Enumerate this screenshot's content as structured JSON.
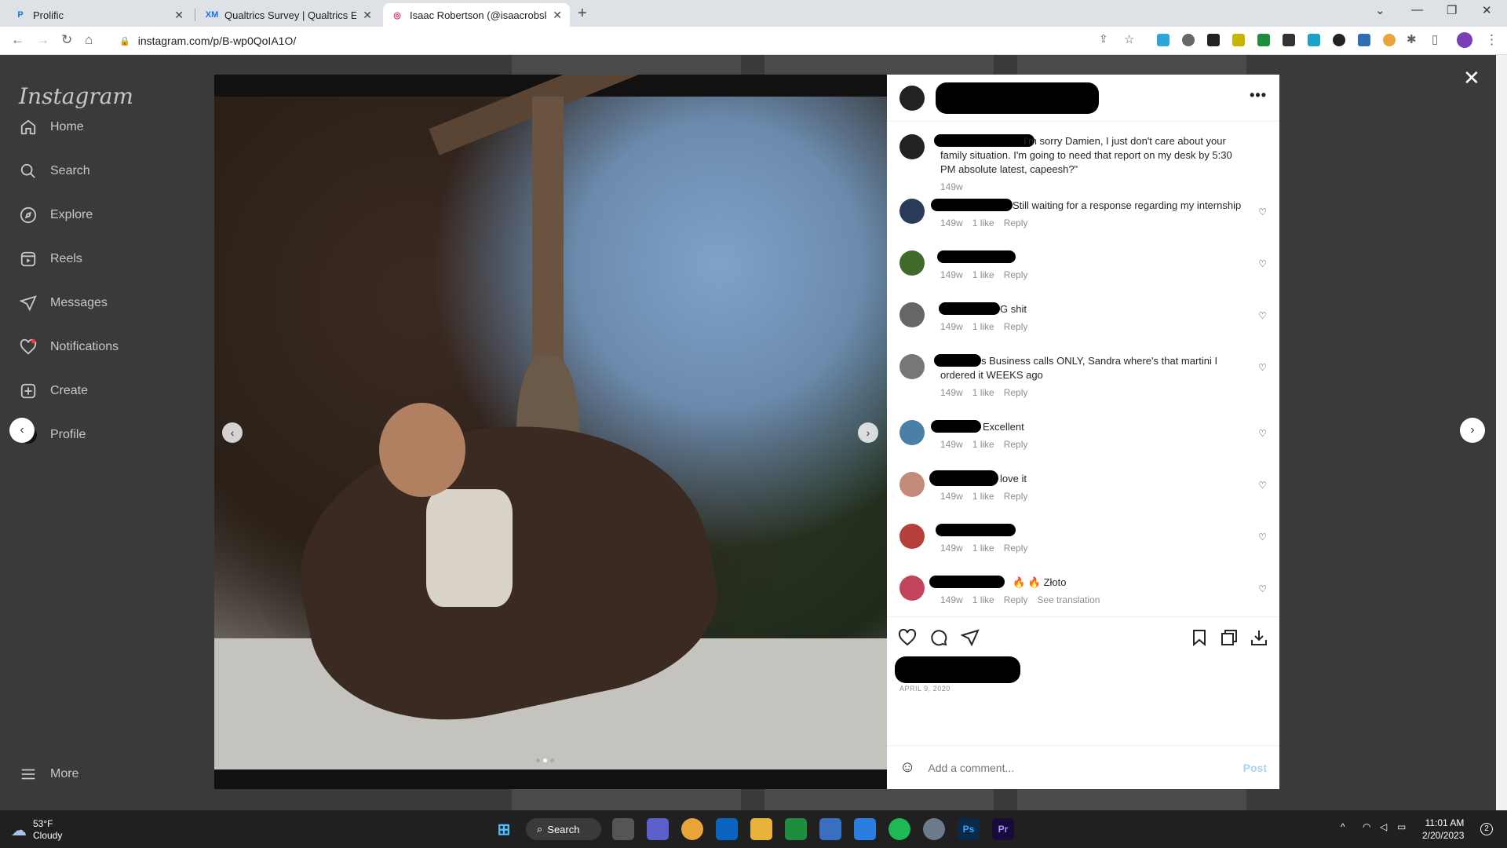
{
  "browser": {
    "tabs": [
      {
        "title": "Prolific",
        "favicon": "prolific-icon"
      },
      {
        "title": "Qualtrics Survey | Qualtrics Exper",
        "favicon": "qualtrics-icon"
      },
      {
        "title": "Isaac Robertson (@isaacrobskrrt",
        "favicon": "instagram-icon"
      }
    ],
    "url": "instagram.com/p/B-wp0QoIA1O/"
  },
  "sidebar": {
    "logo": "Instagram",
    "items": [
      {
        "label": "Home",
        "icon": "home-icon"
      },
      {
        "label": "Search",
        "icon": "search-icon"
      },
      {
        "label": "Explore",
        "icon": "compass-icon"
      },
      {
        "label": "Reels",
        "icon": "reels-icon"
      },
      {
        "label": "Messages",
        "icon": "send-icon"
      },
      {
        "label": "Notifications",
        "icon": "heart-icon"
      },
      {
        "label": "Create",
        "icon": "plus-square-icon"
      },
      {
        "label": "Profile",
        "icon": "profile-avatar"
      }
    ],
    "more": "More"
  },
  "post": {
    "caption": "I'm sorry Damien, I just don't care about your family situation. I'm going to need that report on my desk by 5:30 PM absolute latest, capeesh?\"",
    "caption_time": "149w",
    "date": "APRIL 9, 2020",
    "comments": [
      {
        "text": "Still waiting for a response regarding my internship",
        "time": "149w",
        "likes": "1 like",
        "reply": "Reply"
      },
      {
        "text": "",
        "time": "149w",
        "likes": "1 like",
        "reply": "Reply"
      },
      {
        "text": "G shit",
        "time": "149w",
        "likes": "1 like",
        "reply": "Reply"
      },
      {
        "text": "s Business calls ONLY, Sandra where's that martini I ordered it WEEKS ago",
        "time": "149w",
        "likes": "1 like",
        "reply": "Reply"
      },
      {
        "text": "Excellent",
        "time": "149w",
        "likes": "1 like",
        "reply": "Reply"
      },
      {
        "text": "love it",
        "time": "149w",
        "likes": "1 like",
        "reply": "Reply"
      },
      {
        "text": "",
        "time": "149w",
        "likes": "1 like",
        "reply": "Reply"
      },
      {
        "text": "🔥 🔥 Złoto",
        "time": "149w",
        "likes": "1 like",
        "reply": "Reply",
        "extra": "See translation"
      }
    ],
    "add_comment_placeholder": "Add a comment...",
    "post_button": "Post"
  },
  "taskbar": {
    "weather_temp": "53°F",
    "weather_desc": "Cloudy",
    "search": "Search",
    "time": "11:01 AM",
    "date": "2/20/2023",
    "notif_count": "2"
  },
  "colors": {
    "accent": "#0095f6",
    "post_disabled": "#a7d3f5"
  }
}
